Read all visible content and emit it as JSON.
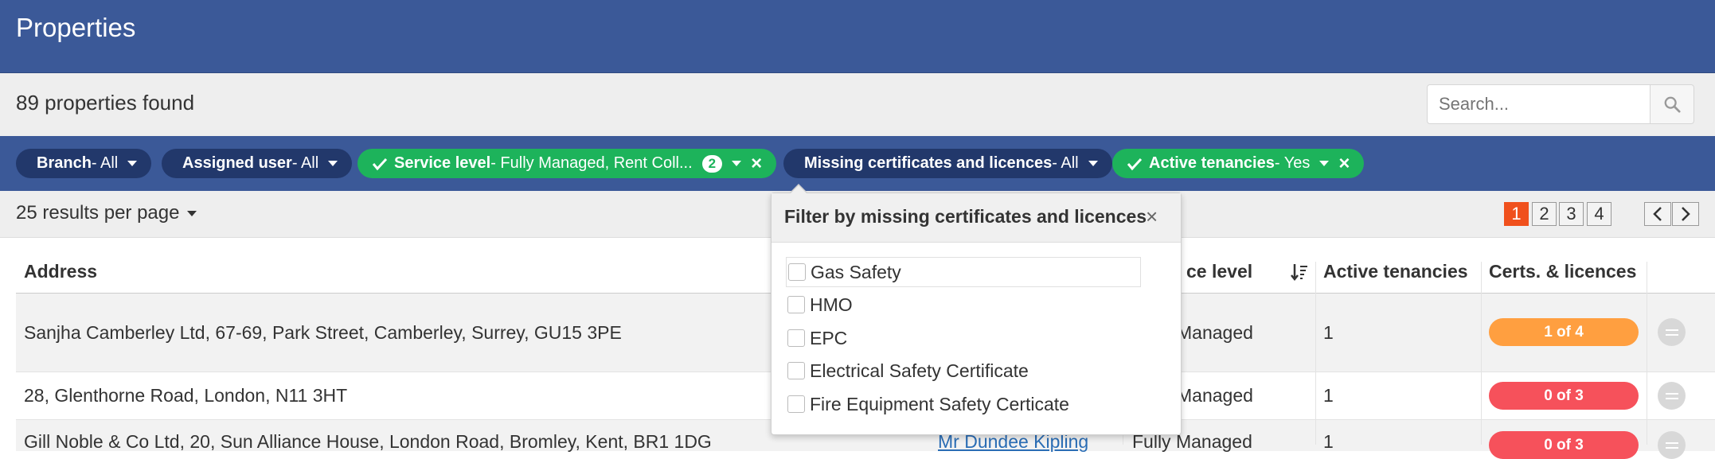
{
  "header": {
    "title": "Properties"
  },
  "summary": {
    "count_text": "89 properties found",
    "search_placeholder": "Search..."
  },
  "filters": {
    "branch": {
      "label": "Branch",
      "value": " - All"
    },
    "assigned_user": {
      "label": "Assigned user",
      "value": " - All"
    },
    "service_level": {
      "label": "Service level",
      "value": " - Fully Managed, Rent Coll...",
      "badge": "2"
    },
    "missing_certs": {
      "label": "Missing certificates and licences",
      "value": " - All"
    },
    "active_tenancies": {
      "label": "Active tenancies",
      "value": " - Yes"
    }
  },
  "toolbar": {
    "per_page": "25 results per page"
  },
  "pagination": {
    "pages": [
      "1",
      "2",
      "3",
      "4"
    ],
    "prev": "<",
    "next": ">"
  },
  "table": {
    "headers": {
      "address": "Address",
      "service_level": "ce level",
      "active_tenancies": "Active tenancies",
      "certs": "Certs. & licences"
    },
    "rows": [
      {
        "address": "Sanjha Camberley Ltd, 67-69, Park Street, Camberley, Surrey, GU15 3PE",
        "service": "Managed",
        "tenancies": "1",
        "certs": "1 of 4"
      },
      {
        "address": "28, Glenthorne Road, London, N11 3HT",
        "service": "Managed",
        "tenancies": "1",
        "certs": "0 of 3"
      },
      {
        "address": "Gill Noble & Co Ltd, 20, Sun Alliance House, London Road, Bromley, Kent, BR1 1DG",
        "user": "Mr Dundee Kipling",
        "service": "Fully Managed",
        "tenancies": "1",
        "certs": "0 of 3"
      }
    ]
  },
  "dropdown": {
    "title": "Filter by missing certificates and licences",
    "options": [
      "Gas Safety",
      "HMO",
      "EPC",
      "Electrical Safety Certificate",
      "Fire Equipment Safety Certicate"
    ]
  },
  "colors": {
    "header_bg": "#3b5998",
    "pill_dark": "#22386b",
    "pill_green": "#1db35b",
    "page_active": "#f0501c",
    "cert_orange": "#ff9f40",
    "cert_red": "#f6515b"
  }
}
